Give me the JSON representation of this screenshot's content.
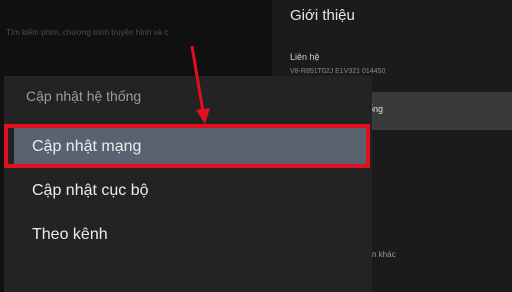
{
  "background": {
    "search_text": "Tìm kiếm phim, chương trình truyền hình và c",
    "panel_title": "Giới thiệu",
    "row_label": "Liên hệ",
    "row_value": "V8-R851T02J E1V321 014450",
    "highlighted_text": "ống",
    "other_text": "tin khác"
  },
  "dialog": {
    "title": "Cập nhật hệ thống",
    "items": [
      {
        "label": "Cập nhật mạng",
        "selected": true
      },
      {
        "label": "Cập nhật cục bộ",
        "selected": false
      },
      {
        "label": "Theo kênh",
        "selected": false
      }
    ]
  },
  "colors": {
    "annotation_red": "#e0101e",
    "selected_item": "#5a6270",
    "dialog_bg": "#232323"
  }
}
